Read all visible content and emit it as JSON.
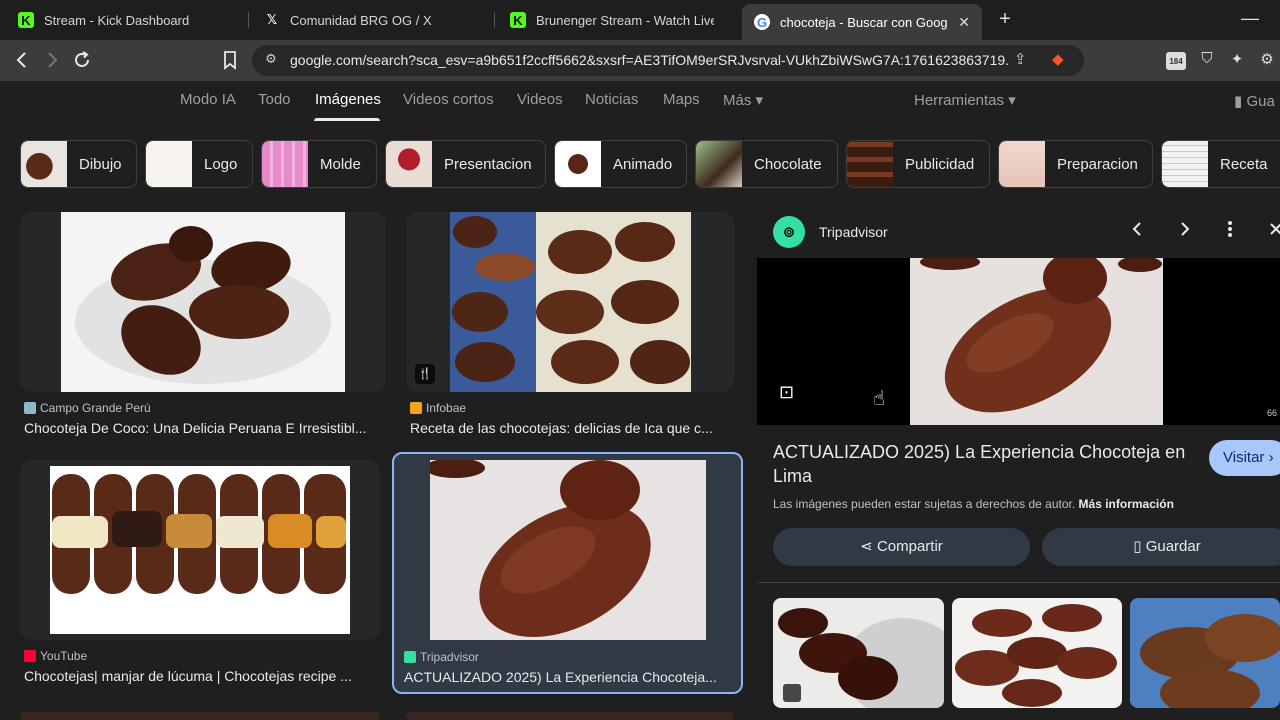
{
  "tabs": [
    {
      "label": "Stream - Kick Dashboard",
      "favicon": "kick-icon"
    },
    {
      "label": "Comunidad BRG OG / X",
      "favicon": "x-icon"
    },
    {
      "label": "Brunenger Stream - Watch Live on Ki",
      "favicon": "kick-icon"
    },
    {
      "label": "chocoteja - Buscar con Google",
      "favicon": "google-icon",
      "active": true
    }
  ],
  "favicon_glyphs": {
    "kick": "K",
    "x": "𝕏",
    "google": "G"
  },
  "tab_close_glyph": "✕",
  "newtab_glyph": "+",
  "minimize_glyph": "—",
  "address": {
    "url": "google.com/search?sca_esv=a9b651f2ccff5662&sxsrf=AE3TifOM9erSRJvsrval-VUkhZbiWSwG7A:1761623863719...",
    "extension_badge": "184"
  },
  "gnav": {
    "items": [
      "Modo IA",
      "Todo",
      "Imágenes",
      "Videos cortos",
      "Videos",
      "Noticias",
      "Maps",
      "Más ▾"
    ],
    "active": "Imágenes",
    "tools": "Herramientas ▾",
    "saved": "Gua"
  },
  "chips": [
    "Dibujo",
    "Logo",
    "Molde",
    "Presentacion",
    "Animado",
    "Chocolate",
    "Publicidad",
    "Preparacion",
    "Receta"
  ],
  "results": [
    {
      "source": "Campo Grande Perú",
      "title": "Chocoteja De Coco: Una Delicia Peruana E Irresistibl..."
    },
    {
      "source": "Infobae",
      "title": "Receta de las chocotejas: delicias de Ica que c..."
    },
    {
      "source": "YouTube",
      "title": "Chocotejas| manjar de lúcuma | Chocotejas recipe ..."
    },
    {
      "source": "Tripadvisor",
      "title": "ACTUALIZADO 2025) La Experiencia Chocoteja..."
    }
  ],
  "recipe_glyph": "🍴",
  "panel": {
    "site": "Tripadvisor",
    "title": "ACTUALIZADO 2025) La Experiencia Chocoteja en Lima",
    "visit": "Visitar ›",
    "copyright": "Las imágenes pueden estar sujetas a derechos de autor.",
    "more_info": "Más información",
    "share": "Compartir",
    "save": "Guardar",
    "counter": "66"
  },
  "colors": {
    "background": "#1f1f1f",
    "accent": "#8ab4f8",
    "visit_button": "#a8c7fa",
    "tripadvisor": "#34e0a1",
    "kick": "#53fc18"
  }
}
